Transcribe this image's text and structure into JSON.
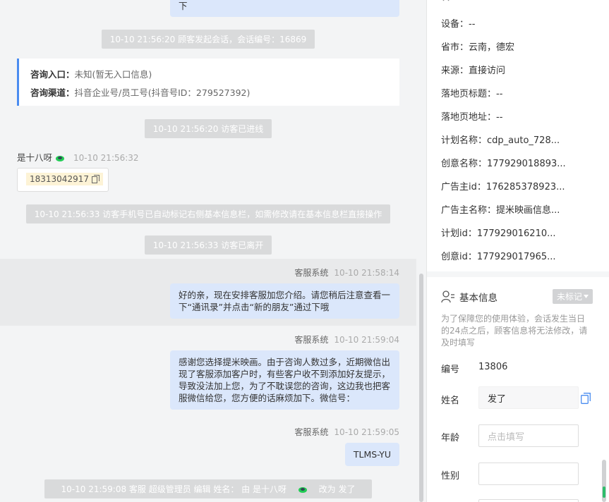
{
  "chat": {
    "top_bubble_tail": "下",
    "sys1": "10-10 21:56:20 顾客发起会话，会话编号：16869",
    "source": {
      "entry_label": "咨询入口：",
      "entry_value": "未知(暂无入口信息)",
      "channel_label": "咨询渠道：",
      "channel_value": "抖音企业号/员工号(抖音号ID：279527392)"
    },
    "sys2": "10-10 21:56:20 访客已进线",
    "visitor": {
      "name": "是十八呀",
      "time": "10-10 21:56:32",
      "phone": "18313042917"
    },
    "sys3": "10-10 21:56:33 访客手机号已自动标记右侧基本信息栏，如需修改请在基本信息栏直接操作",
    "sys4": "10-10 21:56:33 访客已离开",
    "messages": [
      {
        "sender": "客服系统",
        "time": "10-10 21:58:14",
        "text": "好的亲，现在安排客服加您介绍。请您稍后注意查看一下“通讯录”并点击“新的朋友”通过下哦"
      },
      {
        "sender": "客服系统",
        "time": "10-10 21:59:04",
        "text": "感谢您选择提米映画。由于咨询人数过多，近期微信出现了客服添加客户时，有些客户收不到添加好友提示，导致没法加上您，为了不耽误您的咨询，这边我也把客服微信给您，您方便的话麻烦加下。微信号："
      },
      {
        "sender": "客服系统",
        "time": "10-10 21:59:05",
        "text": "TLMS-YU"
      }
    ],
    "sys5_prefix": "10-10 21:59:08 客服 超级管理员 编辑 姓名： 由 是十八呀",
    "sys5_suffix": "改为 发了"
  },
  "side": {
    "info": [
      "设备：--",
      "省市：云南，德宏",
      "来源：直接访问",
      "落地页标题：--",
      "落地页地址：--",
      "计划名称：cdp_auto_728...",
      "创意名称：177929018893...",
      "广告主id：176285378923...",
      "广告主名称：提米映画信息...",
      "计划id：177929016210...",
      "创意id：177929017965..."
    ],
    "basic": {
      "title": "基本信息",
      "tag": "未标记",
      "tip": "为了保障您的使用体验，会话发生当日的24点之后，顾客信息将无法修改，请及时填写",
      "number_label": "编号",
      "number_value": "13806",
      "name_label": "姓名",
      "name_value": "发了",
      "age_label": "年龄",
      "age_placeholder": "点击填写",
      "gender_label": "性别"
    }
  },
  "colors": {
    "accent": "#4a8cf0",
    "bubble": "#dbe7fb",
    "system_pill": "#d9dadb"
  }
}
